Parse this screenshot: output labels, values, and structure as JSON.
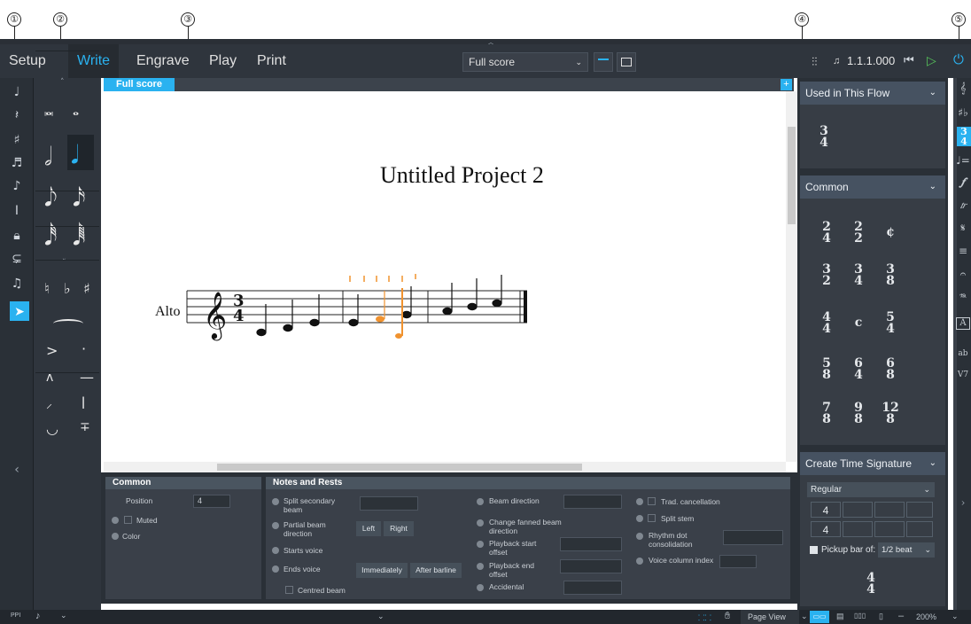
{
  "callouts": [
    "①",
    "②",
    "③",
    "④",
    "⑤"
  ],
  "toolbar": {
    "modes": [
      "Setup",
      "Write",
      "Engrave",
      "Play",
      "Print"
    ],
    "layout_select": "Full score",
    "position": "1.1.1.000"
  },
  "score": {
    "tab": "Full score",
    "title": "Untitled Project 2",
    "instrument": "Alto"
  },
  "properties": {
    "common_header": "Common",
    "position_label": "Position",
    "position_value": "4",
    "muted_label": "Muted",
    "color_label": "Color",
    "notes_header": "Notes and Rests",
    "split_secondary_beam": "Split secondary beam",
    "partial_beam_direction": "Partial beam direction",
    "left_btn": "Left",
    "right_btn": "Right",
    "starts_voice": "Starts voice",
    "ends_voice": "Ends voice",
    "immediately_btn": "Immediately",
    "after_barline_btn": "After barline",
    "centred_beam": "Centred beam",
    "beam_direction": "Beam direction",
    "change_fanned": "Change fanned beam direction",
    "playback_start": "Playback start offset",
    "playback_end": "Playback end offset",
    "accidental": "Accidental",
    "trad_cancellation": "Trad. cancellation",
    "split_stem": "Split stem",
    "rhythm_dot": "Rhythm dot consolidation",
    "voice_column": "Voice column index"
  },
  "right_panel": {
    "used_header": "Used in This Flow",
    "common_header": "Common",
    "create_header": "Create Time Signature",
    "type_select": "Regular",
    "num_value": "4",
    "den_value": "4",
    "pickup_label": "Pickup bar of:",
    "pickup_select": "1/2 beat",
    "used_sigs": [
      [
        "3",
        "4"
      ]
    ],
    "common_sigs": [
      [
        "2",
        "4"
      ],
      [
        "2",
        "2"
      ],
      [
        "¢",
        ""
      ],
      [
        "3",
        "2"
      ],
      [
        "3",
        "4"
      ],
      [
        "3",
        "8"
      ],
      [
        "4",
        "4"
      ],
      [
        "c",
        ""
      ],
      [
        "5",
        "4"
      ],
      [
        "5",
        "8"
      ],
      [
        "6",
        "4"
      ],
      [
        "6",
        "8"
      ],
      [
        "7",
        "8"
      ],
      [
        "9",
        "8"
      ],
      [
        "12",
        "8"
      ]
    ],
    "preview_sig": [
      "4",
      "4"
    ]
  },
  "statusbar": {
    "view_select": "Page View",
    "zoom": "200%"
  },
  "colors": {
    "accent": "#2ab2f0",
    "selection": "#f0922e"
  }
}
